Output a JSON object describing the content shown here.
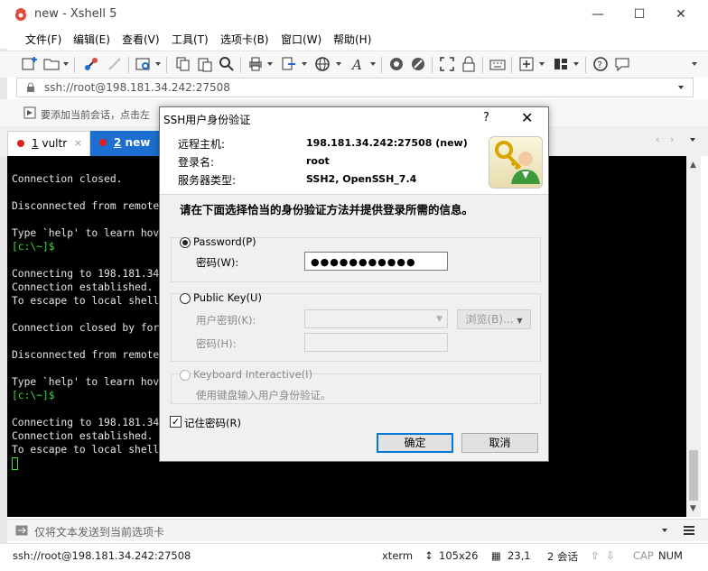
{
  "window": {
    "title": "new - Xshell 5",
    "minimize_icon": "minimize-icon",
    "maximize_icon": "maximize-icon",
    "close_icon": "close-icon"
  },
  "menubar": [
    "文件(F)",
    "编辑(E)",
    "查看(V)",
    "工具(T)",
    "选项卡(B)",
    "窗口(W)",
    "帮助(H)"
  ],
  "addressbar": {
    "value": "ssh://root@198.181.34.242:27508"
  },
  "quickbar": {
    "text": "要添加当前会话，点击左"
  },
  "tabs": [
    {
      "number": "1",
      "label": "vultr",
      "close": "×"
    },
    {
      "number": "2",
      "label": "new",
      "close": "×"
    }
  ],
  "tabnav": {
    "left": "‹",
    "right": "›"
  },
  "terminal": {
    "lines": [
      "Connection closed.",
      "",
      "Disconnected from remote",
      "",
      "Type `help' to learn hov",
      "[c:\\~]$",
      "",
      "Connecting to 198.181.34",
      "Connection established.",
      "To escape to local shell",
      "",
      "Connection closed by for",
      "",
      "Disconnected from remote",
      "",
      "Type `help' to learn hov",
      "[c:\\~]$",
      "",
      "Connecting to 198.181.34",
      "Connection established.",
      "To escape to local shell"
    ],
    "prompt_color": "#3ddc3d"
  },
  "sendbar": {
    "placeholder": "仅将文本发送到当前选项卡"
  },
  "statusbar": {
    "address": "ssh://root@198.181.34.242:27508",
    "term": "xterm",
    "size": "105x26",
    "position": "23,1",
    "sessions": "2 会话",
    "cap": "CAP",
    "num": "NUM"
  },
  "dialog": {
    "title": "SSH用户身份验证",
    "help": "?",
    "close": "✕",
    "remote_host_label": "远程主机:",
    "remote_host_value": "198.181.34.242:27508 (new)",
    "login_label": "登录名:",
    "login_value": "root",
    "server_type_label": "服务器类型:",
    "server_type_value": "SSH2, OpenSSH_7.4",
    "instruction": "请在下面选择恰当的身份验证方法并提供登录所需的信息。",
    "password_method": {
      "label": "Password(P)",
      "field_label": "密码(W):",
      "value": "●●●●●●●●●●●"
    },
    "publickey_method": {
      "label": "Public Key(U)",
      "key_label": "用户密钥(K):",
      "browse_label": "浏览(B)...",
      "passphrase_label": "密码(H):"
    },
    "keyboard_method": {
      "label": "Keyboard Interactive(I)",
      "description": "使用键盘输入用户身份验证。"
    },
    "remember_label": "记住密码(R)",
    "ok_label": "确定",
    "cancel_label": "取消"
  },
  "colors": {
    "accent": "#1c6fd0",
    "tab_dot": "#e0201e",
    "primary_border": "#0078d7"
  }
}
